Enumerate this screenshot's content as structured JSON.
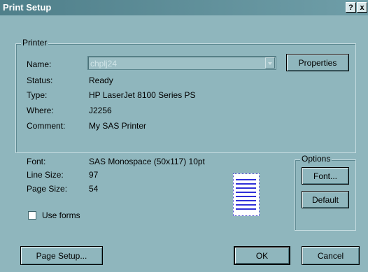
{
  "window": {
    "title": "Print Setup",
    "help_label": "?",
    "close_label": "x"
  },
  "printer": {
    "group_label": "Printer",
    "name_label": "Name:",
    "name_value": "chplj24",
    "properties_label": "Properties",
    "status_label": "Status:",
    "status_value": "Ready",
    "type_label": "Type:",
    "type_value": "HP LaserJet 8100 Series PS",
    "where_label": "Where:",
    "where_value": "J2256",
    "comment_label": "Comment:",
    "comment_value": "My SAS Printer"
  },
  "details": {
    "font_label": "Font:",
    "font_value": "SAS Monospace (50x117) 10pt",
    "line_size_label": "Line Size:",
    "line_size_value": "97",
    "page_size_label": "Page Size:",
    "page_size_value": "54",
    "use_forms_label": "Use forms",
    "use_forms_checked": false
  },
  "options": {
    "group_label": "Options",
    "font_button": "Font...",
    "default_button": "Default"
  },
  "footer": {
    "page_setup_button": "Page Setup...",
    "ok_button": "OK",
    "cancel_button": "Cancel"
  },
  "icons": {
    "help": "question-mark",
    "close": "close-x",
    "dropdown": "chevron-down",
    "preview": "page-preview"
  },
  "colors": {
    "dialog_bg": "#8fb6bd",
    "titlebar": "#5e8f99",
    "preview_lines": "#2f2fd8"
  }
}
